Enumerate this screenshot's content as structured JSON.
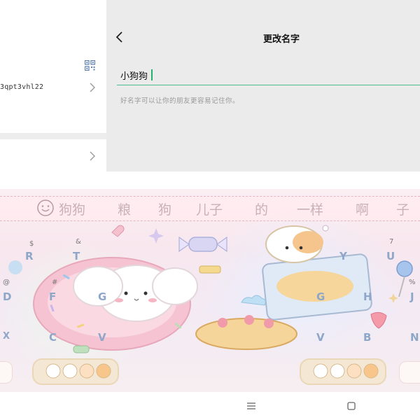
{
  "left_pane": {
    "id_text": "3qpt3vhl22"
  },
  "header": {
    "title": "更改名字",
    "back_icon": "chevron-left-icon"
  },
  "name_field": {
    "value": "小狗狗"
  },
  "hint": "好名字可以让你的朋友更容易记住你。",
  "keyboard": {
    "candidates": [
      "狗狗",
      "粮",
      "狗",
      "儿子",
      "的",
      "一样",
      "啊",
      "子"
    ],
    "letters_left": [
      "R",
      "T",
      "F",
      "G",
      "C",
      "V"
    ],
    "letters_right": [
      "Y",
      "U",
      "G",
      "H",
      "J",
      "V",
      "B",
      "N"
    ],
    "symbols": [
      "$",
      "#",
      "&",
      "7",
      "@",
      "X",
      "%"
    ],
    "colors": {
      "key_letter": "#8ea7c8",
      "candidate": "#c9b1b8"
    }
  },
  "navbar": {
    "menu_icon": "menu-icon",
    "home_icon": "square-home-icon"
  },
  "colors": {
    "accent": "#4bbd8f",
    "caret": "#22b46e"
  }
}
